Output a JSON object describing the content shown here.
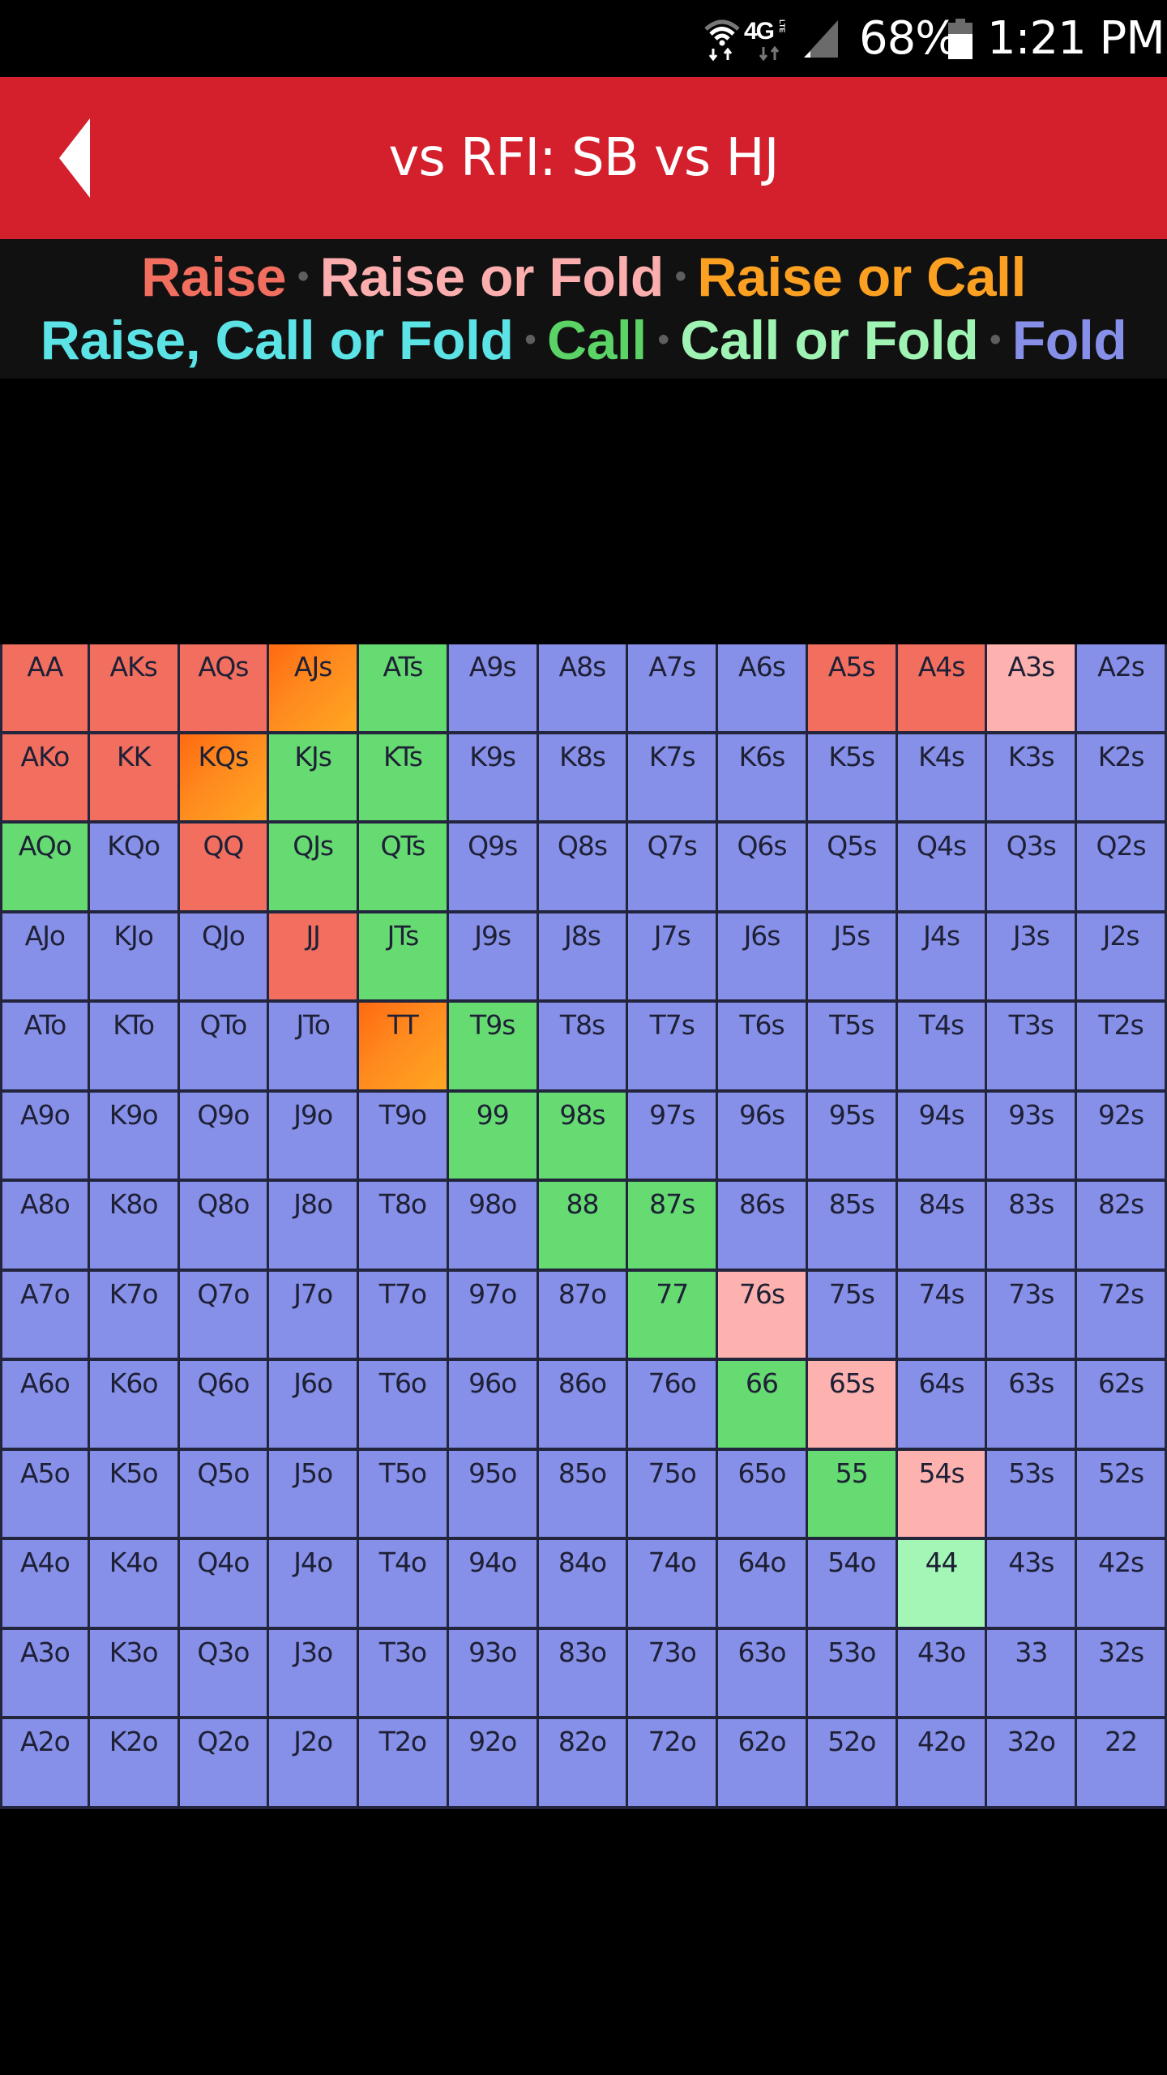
{
  "status_bar": {
    "wifi_icon": "wifi-icon",
    "network_label": "4G",
    "network_sub": "LTE",
    "signal_icon": "signal-icon",
    "battery_percent": "68%",
    "battery_icon": "battery-icon",
    "time": "1:21 PM"
  },
  "app_bar": {
    "back_icon": "back-arrow-icon",
    "title": "vs RFI: SB vs HJ",
    "color": "#d41f2c"
  },
  "legend": {
    "separator": "•",
    "line1": [
      {
        "key": "raise",
        "label": "Raise",
        "color": "#f26f60"
      },
      {
        "key": "raise_or_fold",
        "label": "Raise or Fold",
        "color": "#fcaeae"
      },
      {
        "key": "raise_or_call",
        "label": "Raise or Call",
        "color": "#fca022"
      }
    ],
    "line2": [
      {
        "key": "raise_call_or_fold",
        "label": "Raise, Call or Fold",
        "color": "#5ce3e6"
      },
      {
        "key": "call",
        "label": "Call",
        "color": "#5bd366"
      },
      {
        "key": "call_or_fold",
        "label": "Call or Fold",
        "color": "#9ff4b4"
      },
      {
        "key": "fold",
        "label": "Fold",
        "color": "#8790e8"
      }
    ]
  },
  "action_colors": {
    "raise": "#f26f60",
    "raise_or_fold": "#fdb2b0",
    "raise_or_call": "linear-gradient(135deg, #ff6a12 0%, #ff8a1e 45%, #ffa722 100%)",
    "call": "#66db72",
    "call_or_fold": "#a3f6b5",
    "fold": "#8790e8"
  },
  "hand_grid": {
    "rows": [
      [
        [
          "AA",
          "raise"
        ],
        [
          "AKs",
          "raise"
        ],
        [
          "AQs",
          "raise"
        ],
        [
          "AJs",
          "raise_or_call"
        ],
        [
          "ATs",
          "call"
        ],
        [
          "A9s",
          "fold"
        ],
        [
          "A8s",
          "fold"
        ],
        [
          "A7s",
          "fold"
        ],
        [
          "A6s",
          "fold"
        ],
        [
          "A5s",
          "raise"
        ],
        [
          "A4s",
          "raise"
        ],
        [
          "A3s",
          "raise_or_fold"
        ],
        [
          "A2s",
          "fold"
        ]
      ],
      [
        [
          "AKo",
          "raise"
        ],
        [
          "KK",
          "raise"
        ],
        [
          "KQs",
          "raise_or_call"
        ],
        [
          "KJs",
          "call"
        ],
        [
          "KTs",
          "call"
        ],
        [
          "K9s",
          "fold"
        ],
        [
          "K8s",
          "fold"
        ],
        [
          "K7s",
          "fold"
        ],
        [
          "K6s",
          "fold"
        ],
        [
          "K5s",
          "fold"
        ],
        [
          "K4s",
          "fold"
        ],
        [
          "K3s",
          "fold"
        ],
        [
          "K2s",
          "fold"
        ]
      ],
      [
        [
          "AQo",
          "call"
        ],
        [
          "KQo",
          "fold"
        ],
        [
          "QQ",
          "raise"
        ],
        [
          "QJs",
          "call"
        ],
        [
          "QTs",
          "call"
        ],
        [
          "Q9s",
          "fold"
        ],
        [
          "Q8s",
          "fold"
        ],
        [
          "Q7s",
          "fold"
        ],
        [
          "Q6s",
          "fold"
        ],
        [
          "Q5s",
          "fold"
        ],
        [
          "Q4s",
          "fold"
        ],
        [
          "Q3s",
          "fold"
        ],
        [
          "Q2s",
          "fold"
        ]
      ],
      [
        [
          "AJo",
          "fold"
        ],
        [
          "KJo",
          "fold"
        ],
        [
          "QJo",
          "fold"
        ],
        [
          "JJ",
          "raise"
        ],
        [
          "JTs",
          "call"
        ],
        [
          "J9s",
          "fold"
        ],
        [
          "J8s",
          "fold"
        ],
        [
          "J7s",
          "fold"
        ],
        [
          "J6s",
          "fold"
        ],
        [
          "J5s",
          "fold"
        ],
        [
          "J4s",
          "fold"
        ],
        [
          "J3s",
          "fold"
        ],
        [
          "J2s",
          "fold"
        ]
      ],
      [
        [
          "ATo",
          "fold"
        ],
        [
          "KTo",
          "fold"
        ],
        [
          "QTo",
          "fold"
        ],
        [
          "JTo",
          "fold"
        ],
        [
          "TT",
          "raise_or_call"
        ],
        [
          "T9s",
          "call"
        ],
        [
          "T8s",
          "fold"
        ],
        [
          "T7s",
          "fold"
        ],
        [
          "T6s",
          "fold"
        ],
        [
          "T5s",
          "fold"
        ],
        [
          "T4s",
          "fold"
        ],
        [
          "T3s",
          "fold"
        ],
        [
          "T2s",
          "fold"
        ]
      ],
      [
        [
          "A9o",
          "fold"
        ],
        [
          "K9o",
          "fold"
        ],
        [
          "Q9o",
          "fold"
        ],
        [
          "J9o",
          "fold"
        ],
        [
          "T9o",
          "fold"
        ],
        [
          "99",
          "call"
        ],
        [
          "98s",
          "call"
        ],
        [
          "97s",
          "fold"
        ],
        [
          "96s",
          "fold"
        ],
        [
          "95s",
          "fold"
        ],
        [
          "94s",
          "fold"
        ],
        [
          "93s",
          "fold"
        ],
        [
          "92s",
          "fold"
        ]
      ],
      [
        [
          "A8o",
          "fold"
        ],
        [
          "K8o",
          "fold"
        ],
        [
          "Q8o",
          "fold"
        ],
        [
          "J8o",
          "fold"
        ],
        [
          "T8o",
          "fold"
        ],
        [
          "98o",
          "fold"
        ],
        [
          "88",
          "call"
        ],
        [
          "87s",
          "call"
        ],
        [
          "86s",
          "fold"
        ],
        [
          "85s",
          "fold"
        ],
        [
          "84s",
          "fold"
        ],
        [
          "83s",
          "fold"
        ],
        [
          "82s",
          "fold"
        ]
      ],
      [
        [
          "A7o",
          "fold"
        ],
        [
          "K7o",
          "fold"
        ],
        [
          "Q7o",
          "fold"
        ],
        [
          "J7o",
          "fold"
        ],
        [
          "T7o",
          "fold"
        ],
        [
          "97o",
          "fold"
        ],
        [
          "87o",
          "fold"
        ],
        [
          "77",
          "call"
        ],
        [
          "76s",
          "raise_or_fold"
        ],
        [
          "75s",
          "fold"
        ],
        [
          "74s",
          "fold"
        ],
        [
          "73s",
          "fold"
        ],
        [
          "72s",
          "fold"
        ]
      ],
      [
        [
          "A6o",
          "fold"
        ],
        [
          "K6o",
          "fold"
        ],
        [
          "Q6o",
          "fold"
        ],
        [
          "J6o",
          "fold"
        ],
        [
          "T6o",
          "fold"
        ],
        [
          "96o",
          "fold"
        ],
        [
          "86o",
          "fold"
        ],
        [
          "76o",
          "fold"
        ],
        [
          "66",
          "call"
        ],
        [
          "65s",
          "raise_or_fold"
        ],
        [
          "64s",
          "fold"
        ],
        [
          "63s",
          "fold"
        ],
        [
          "62s",
          "fold"
        ]
      ],
      [
        [
          "A5o",
          "fold"
        ],
        [
          "K5o",
          "fold"
        ],
        [
          "Q5o",
          "fold"
        ],
        [
          "J5o",
          "fold"
        ],
        [
          "T5o",
          "fold"
        ],
        [
          "95o",
          "fold"
        ],
        [
          "85o",
          "fold"
        ],
        [
          "75o",
          "fold"
        ],
        [
          "65o",
          "fold"
        ],
        [
          "55",
          "call"
        ],
        [
          "54s",
          "raise_or_fold"
        ],
        [
          "53s",
          "fold"
        ],
        [
          "52s",
          "fold"
        ]
      ],
      [
        [
          "A4o",
          "fold"
        ],
        [
          "K4o",
          "fold"
        ],
        [
          "Q4o",
          "fold"
        ],
        [
          "J4o",
          "fold"
        ],
        [
          "T4o",
          "fold"
        ],
        [
          "94o",
          "fold"
        ],
        [
          "84o",
          "fold"
        ],
        [
          "74o",
          "fold"
        ],
        [
          "64o",
          "fold"
        ],
        [
          "54o",
          "fold"
        ],
        [
          "44",
          "call_or_fold"
        ],
        [
          "43s",
          "fold"
        ],
        [
          "42s",
          "fold"
        ]
      ],
      [
        [
          "A3o",
          "fold"
        ],
        [
          "K3o",
          "fold"
        ],
        [
          "Q3o",
          "fold"
        ],
        [
          "J3o",
          "fold"
        ],
        [
          "T3o",
          "fold"
        ],
        [
          "93o",
          "fold"
        ],
        [
          "83o",
          "fold"
        ],
        [
          "73o",
          "fold"
        ],
        [
          "63o",
          "fold"
        ],
        [
          "53o",
          "fold"
        ],
        [
          "43o",
          "fold"
        ],
        [
          "33",
          "fold"
        ],
        [
          "32s",
          "fold"
        ]
      ],
      [
        [
          "A2o",
          "fold"
        ],
        [
          "K2o",
          "fold"
        ],
        [
          "Q2o",
          "fold"
        ],
        [
          "J2o",
          "fold"
        ],
        [
          "T2o",
          "fold"
        ],
        [
          "92o",
          "fold"
        ],
        [
          "82o",
          "fold"
        ],
        [
          "72o",
          "fold"
        ],
        [
          "62o",
          "fold"
        ],
        [
          "52o",
          "fold"
        ],
        [
          "42o",
          "fold"
        ],
        [
          "32o",
          "fold"
        ],
        [
          "22",
          "fold"
        ]
      ]
    ]
  }
}
